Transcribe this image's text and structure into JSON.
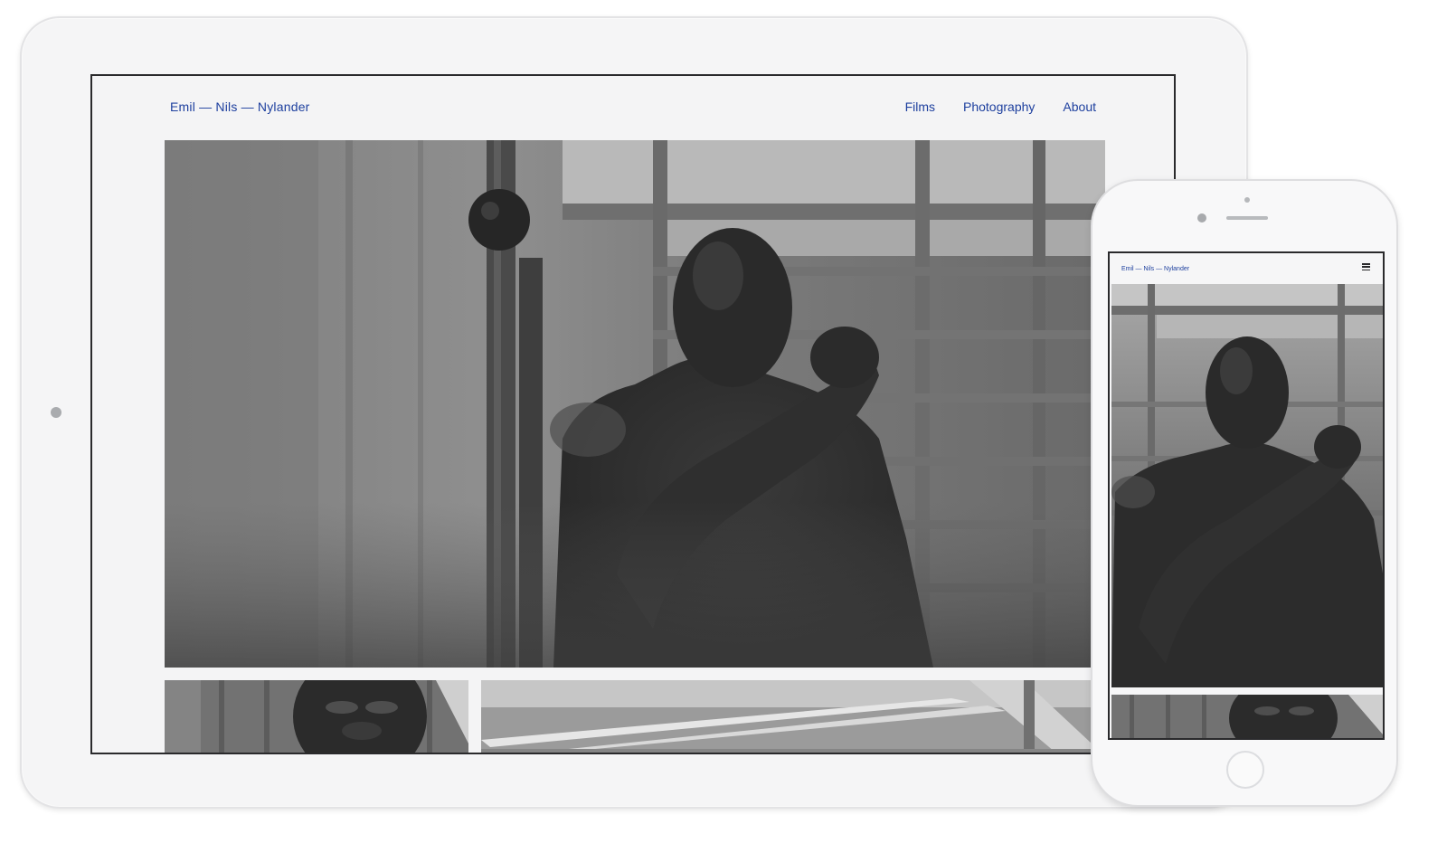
{
  "site": {
    "title": "Emil — Nils — Nylander",
    "nav": [
      "Films",
      "Photography",
      "About"
    ]
  },
  "mobile": {
    "title": "Emil — Nils — Nylander",
    "menu_icon": "hamburger-menu-icon"
  },
  "images": {
    "hero": "black-and-white photo of a boxer with a climbing rope in a gym",
    "thumb_1": "black-and-white portrait of a man against wooden planks",
    "thumb_2": "black-and-white photo of gym ceiling lights"
  },
  "colors": {
    "link": "#1d3f9e",
    "device_body": "#f5f5f6",
    "screen_border": "#2a2a2c"
  }
}
